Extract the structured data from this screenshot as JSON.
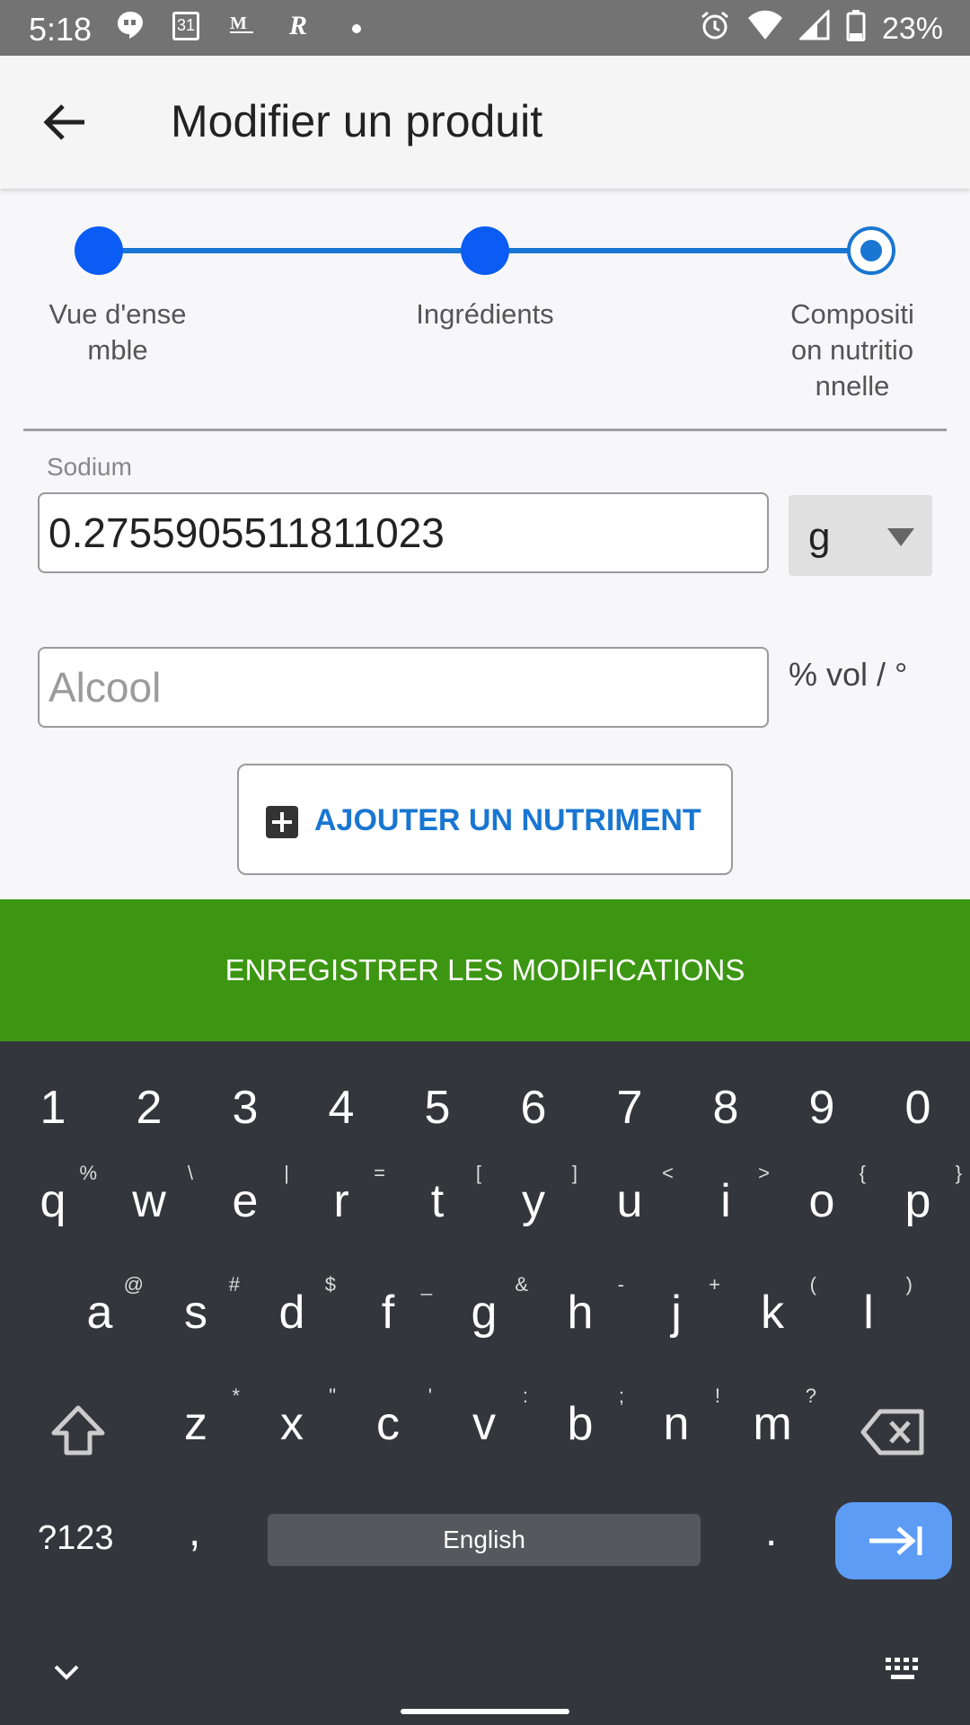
{
  "status_bar": {
    "time": "5:18",
    "calendar_day": "31",
    "battery": "23%",
    "icons_left": [
      "hangouts-icon",
      "calendar-icon",
      "gmail-icon",
      "r-app-icon",
      "dot-icon"
    ],
    "icons_right": [
      "alarm-icon",
      "wifi-icon",
      "signal-icon",
      "battery-icon"
    ]
  },
  "app_bar": {
    "title": "Modifier un produit"
  },
  "stepper": {
    "steps": [
      {
        "label": "Vue d'ense\nmble",
        "state": "done"
      },
      {
        "label": "Ingrédients",
        "state": "done"
      },
      {
        "label": "Compositi\non nutritio\nnnelle",
        "state": "current"
      }
    ]
  },
  "form": {
    "sodium_label": "Sodium",
    "sodium_value": "0.2755905511811023",
    "sodium_unit": "g",
    "alcool_placeholder": "Alcool",
    "alcool_unit": "% vol / °",
    "add_nutrient_label": "AJOUTER UN NUTRIMENT"
  },
  "save_button": {
    "label": "ENREGISTRER LES MODIFICATIONS"
  },
  "keyboard": {
    "numbers": [
      "1",
      "2",
      "3",
      "4",
      "5",
      "6",
      "7",
      "8",
      "9",
      "0"
    ],
    "row1": [
      [
        "q",
        "%"
      ],
      [
        "w",
        "\\"
      ],
      [
        "e",
        "|"
      ],
      [
        "r",
        "="
      ],
      [
        "t",
        "["
      ],
      [
        "y",
        "]"
      ],
      [
        "u",
        "<"
      ],
      [
        "i",
        ">"
      ],
      [
        "o",
        "{"
      ],
      [
        "p",
        "}"
      ]
    ],
    "row2": [
      [
        "a",
        "@"
      ],
      [
        "s",
        "#"
      ],
      [
        "d",
        "$"
      ],
      [
        "f",
        "_"
      ],
      [
        "g",
        "&"
      ],
      [
        "h",
        "-"
      ],
      [
        "j",
        "+"
      ],
      [
        "k",
        "("
      ],
      [
        "l",
        ")"
      ]
    ],
    "row3": [
      [
        "z",
        "*"
      ],
      [
        "x",
        "\""
      ],
      [
        "c",
        "'"
      ],
      [
        "v",
        ":"
      ],
      [
        "b",
        ";"
      ],
      [
        "n",
        "!"
      ],
      [
        "m",
        "?"
      ]
    ],
    "symbols_key": "?123",
    "comma_key": ",",
    "space_label": "English",
    "period_key": "."
  },
  "colors": {
    "accent": "#1976d2",
    "save_bar": "#3c9612",
    "keyboard_bg": "#33363b",
    "enter_key": "#5c9cf5"
  }
}
